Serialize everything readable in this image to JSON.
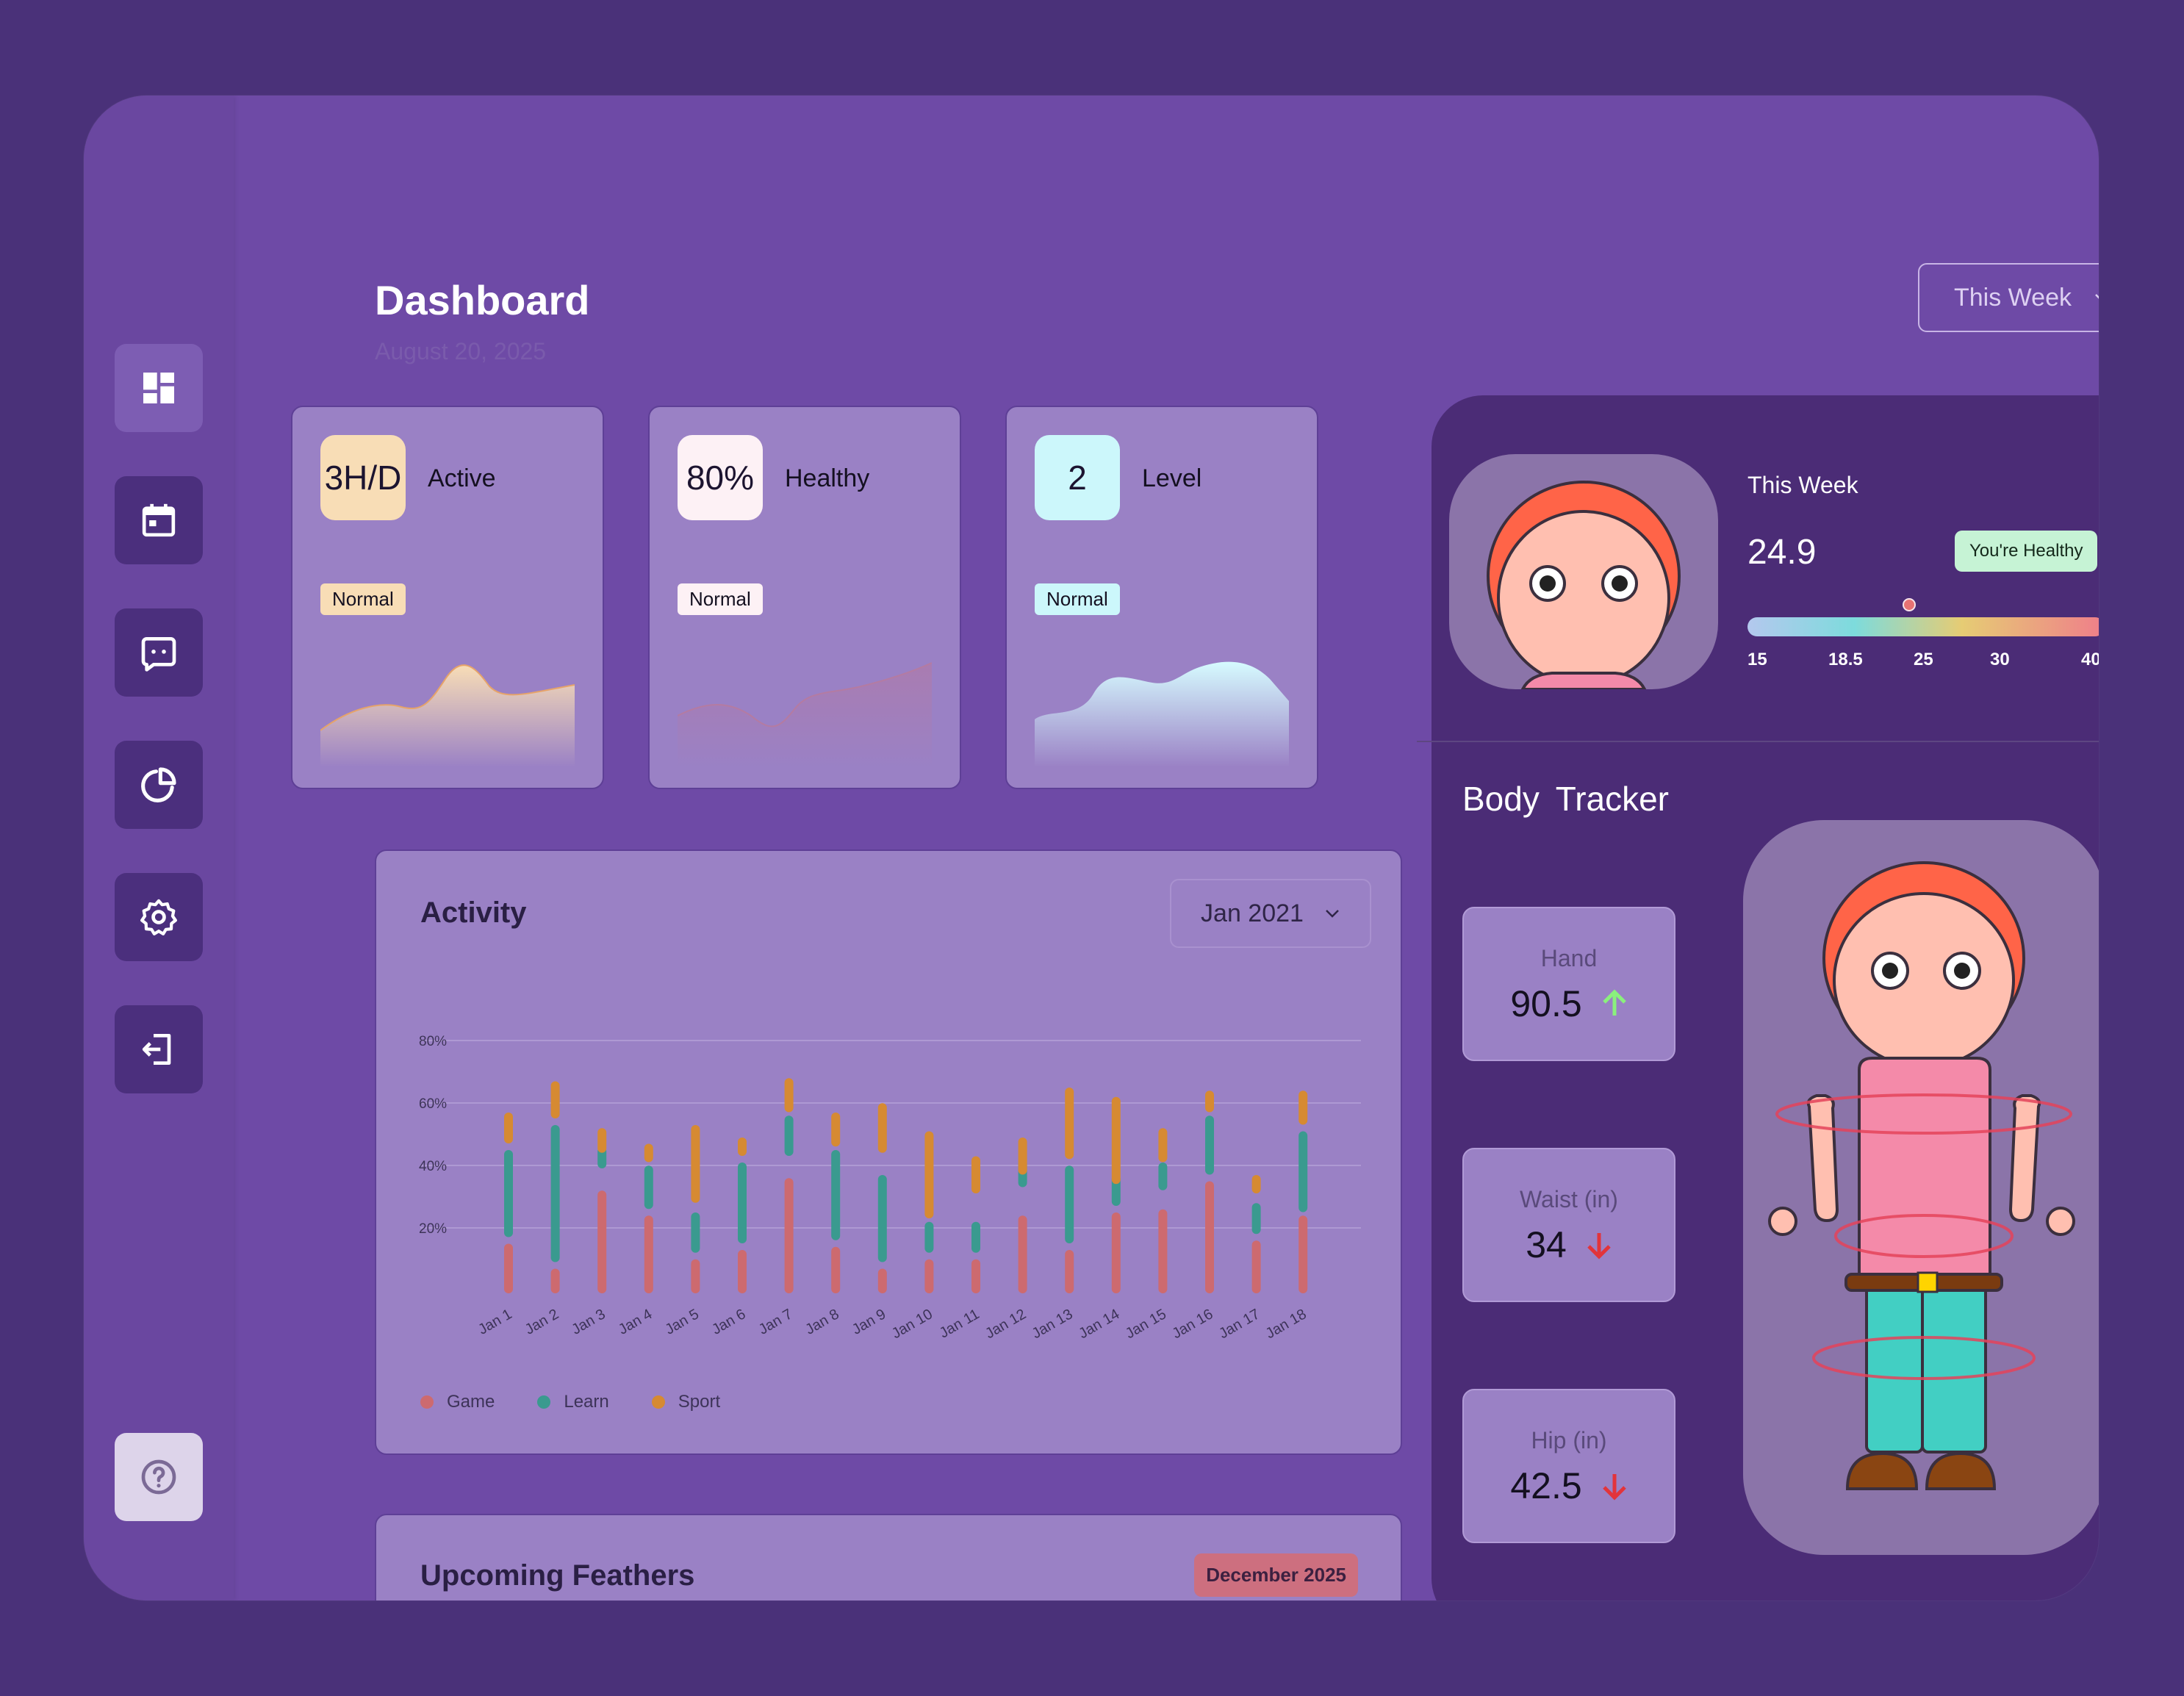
{
  "header": {
    "title": "Dashboard",
    "date": "August 20, 2025",
    "period_select": "This Week"
  },
  "sidebar": {
    "items": [
      {
        "name": "dashboard",
        "icon": "dashboard-icon",
        "active": true
      },
      {
        "name": "calendar",
        "icon": "calendar-icon",
        "active": false
      },
      {
        "name": "messages",
        "icon": "chat-icon",
        "active": false
      },
      {
        "name": "reports",
        "icon": "pie-chart-icon",
        "active": false
      },
      {
        "name": "settings",
        "icon": "gear-icon",
        "active": false
      },
      {
        "name": "logout",
        "icon": "logout-icon",
        "active": false
      }
    ],
    "help_icon": "help-icon"
  },
  "stats": [
    {
      "value": "3H/D",
      "label": "Active",
      "badge": "Normal",
      "icon_bg": "#f8ddb6",
      "badge_bg": "#f8ddb6"
    },
    {
      "value": "80%",
      "label": "Healthy",
      "badge": "Normal",
      "icon_bg": "#fdf1f5",
      "badge_bg": "#fdf1f5"
    },
    {
      "value": "2",
      "label": "Level",
      "badge": "Normal",
      "icon_bg": "#ccf7fb",
      "badge_bg": "#ccf7fb"
    }
  ],
  "activity": {
    "title": "Activity",
    "month_select": "Jan 2021",
    "legend": [
      {
        "name": "Game",
        "color": "#cd6a6f"
      },
      {
        "name": "Learn",
        "color": "#3a9a8f"
      },
      {
        "name": "Sport",
        "color": "#d68a32"
      }
    ]
  },
  "chart_data": {
    "type": "bar",
    "categories": [
      "Jan 1",
      "Jan 2",
      "Jan 3",
      "Jan 4",
      "Jan 5",
      "Jan 6",
      "Jan 7",
      "Jan 8",
      "Jan 9",
      "Jan 10",
      "Jan 11",
      "Jan 12",
      "Jan 13",
      "Jan 14",
      "Jan 15",
      "Jan 16",
      "Jan 17",
      "Jan 18"
    ],
    "ylim": [
      0,
      80
    ],
    "yticks": [
      "20%",
      "40%",
      "60%",
      "80%"
    ],
    "grid": true,
    "legend_position": "bottom-left",
    "series": [
      {
        "name": "Game",
        "ranges": [
          [
            0,
            14
          ],
          [
            0,
            6
          ],
          [
            0,
            31
          ],
          [
            0,
            23
          ],
          [
            0,
            9
          ],
          [
            0,
            12
          ],
          [
            0,
            35
          ],
          [
            0,
            13
          ],
          [
            0,
            6
          ],
          [
            0,
            9
          ],
          [
            0,
            9
          ],
          [
            0,
            23
          ],
          [
            0,
            12
          ],
          [
            0,
            24
          ],
          [
            0,
            25
          ],
          [
            0,
            34
          ],
          [
            0,
            15
          ],
          [
            0,
            23
          ]
        ]
      },
      {
        "name": "Learn",
        "ranges": [
          [
            18,
            44
          ],
          [
            10,
            52
          ],
          [
            40,
            45
          ],
          [
            27,
            39
          ],
          [
            13,
            24
          ],
          [
            16,
            40
          ],
          [
            44,
            55
          ],
          [
            17,
            44
          ],
          [
            10,
            36
          ],
          [
            13,
            21
          ],
          [
            13,
            21
          ],
          [
            34,
            41
          ],
          [
            16,
            39
          ],
          [
            28,
            36
          ],
          [
            33,
            40
          ],
          [
            38,
            55
          ],
          [
            19,
            27
          ],
          [
            26,
            50
          ]
        ]
      },
      {
        "name": "Sport",
        "ranges": [
          [
            48,
            56
          ],
          [
            56,
            66
          ],
          [
            45,
            51
          ],
          [
            42,
            46
          ],
          [
            29,
            52
          ],
          [
            44,
            48
          ],
          [
            58,
            67
          ],
          [
            47,
            56
          ],
          [
            45,
            59
          ],
          [
            24,
            50
          ],
          [
            32,
            42
          ],
          [
            38,
            48
          ],
          [
            43,
            64
          ],
          [
            35,
            61
          ],
          [
            42,
            51
          ],
          [
            58,
            63
          ],
          [
            32,
            36
          ],
          [
            54,
            63
          ]
        ]
      }
    ]
  },
  "upcoming": {
    "title": "Upcoming Feathers",
    "badge": "December 2025"
  },
  "bmi": {
    "label": "This Week",
    "value": "24.9",
    "status": "You're Healthy",
    "scale": [
      "15",
      "18.5",
      "25",
      "30",
      "40"
    ],
    "marker": 0.45
  },
  "tracker": {
    "title": "Body  Tracker",
    "measures": [
      {
        "label": "Hand",
        "value": "90.5",
        "trend": "up",
        "color": "#8af07d"
      },
      {
        "label": "Waist (in)",
        "value": "34",
        "trend": "down",
        "color": "#e2343b"
      },
      {
        "label": "Hip (in)",
        "value": "42.5",
        "trend": "down",
        "color": "#e2343b"
      }
    ]
  }
}
